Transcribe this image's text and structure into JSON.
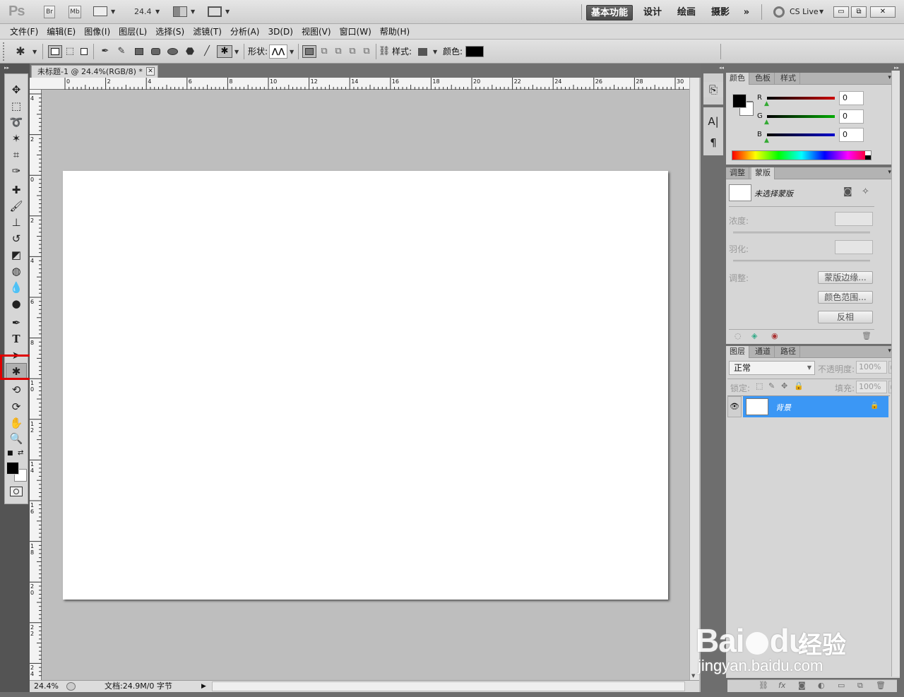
{
  "app": {
    "logo": "Ps",
    "br": "Br",
    "mb": "Mb",
    "zoom": "24.4"
  },
  "workspaces": [
    "基本功能",
    "设计",
    "绘画",
    "摄影"
  ],
  "more_label": "»",
  "cslive": "CS Live",
  "window_buttons": [
    "▭",
    "⧉",
    "✕"
  ],
  "menu": [
    "文件(F)",
    "编辑(E)",
    "图像(I)",
    "图层(L)",
    "选择(S)",
    "滤镜(T)",
    "分析(A)",
    "3D(D)",
    "视图(V)",
    "窗口(W)",
    "帮助(H)"
  ],
  "options": {
    "shape_label": "形状:",
    "style_label": "样式:",
    "color_label": "颜色:"
  },
  "document": {
    "tab_title": "未标题-1 @ 24.4%(RGB/8) *",
    "close": "✕"
  },
  "ruler_top": [
    "0",
    "2",
    "4",
    "6",
    "8",
    "10",
    "12",
    "14",
    "16",
    "18",
    "20",
    "22",
    "24",
    "26",
    "28",
    "30"
  ],
  "ruler_left": [
    "4",
    "2",
    "0",
    "2",
    "4",
    "6",
    "8",
    "1 0",
    "1 2",
    "1 4",
    "1 6",
    "1 8",
    "2 0",
    "2 2",
    "2 4"
  ],
  "status": {
    "zoom": "24.4%",
    "doc": "文档:24.9M/0 字节"
  },
  "mid_icons": [
    "A|",
    "¶"
  ],
  "color_panel": {
    "tabs": [
      "颜色",
      "色板",
      "样式"
    ],
    "channels": [
      {
        "label": "R",
        "value": "0"
      },
      {
        "label": "G",
        "value": "0"
      },
      {
        "label": "B",
        "value": "0"
      }
    ],
    "channel_colors": [
      "#cc0000",
      "#00aa00",
      "#0000cc"
    ]
  },
  "mask_panel": {
    "tabs": [
      "调整",
      "蒙版"
    ],
    "no_mask": "未选择蒙版",
    "density": "浓度:",
    "feather": "羽化:",
    "adjust": "调整:",
    "btn_edge": "蒙版边缘...",
    "btn_range": "颜色范围...",
    "btn_invert": "反相"
  },
  "layers_panel": {
    "tabs": [
      "图层",
      "通道",
      "路径"
    ],
    "blend": "正常",
    "opacity_label": "不透明度:",
    "opacity": "100%",
    "lock_label": "锁定:",
    "fill_label": "填充:",
    "fill": "100%",
    "layer_name": "背景"
  },
  "watermark": {
    "brand": "Bai",
    "brand2": "du",
    "cn": "经验",
    "url": "jingyan.baidu.com"
  }
}
